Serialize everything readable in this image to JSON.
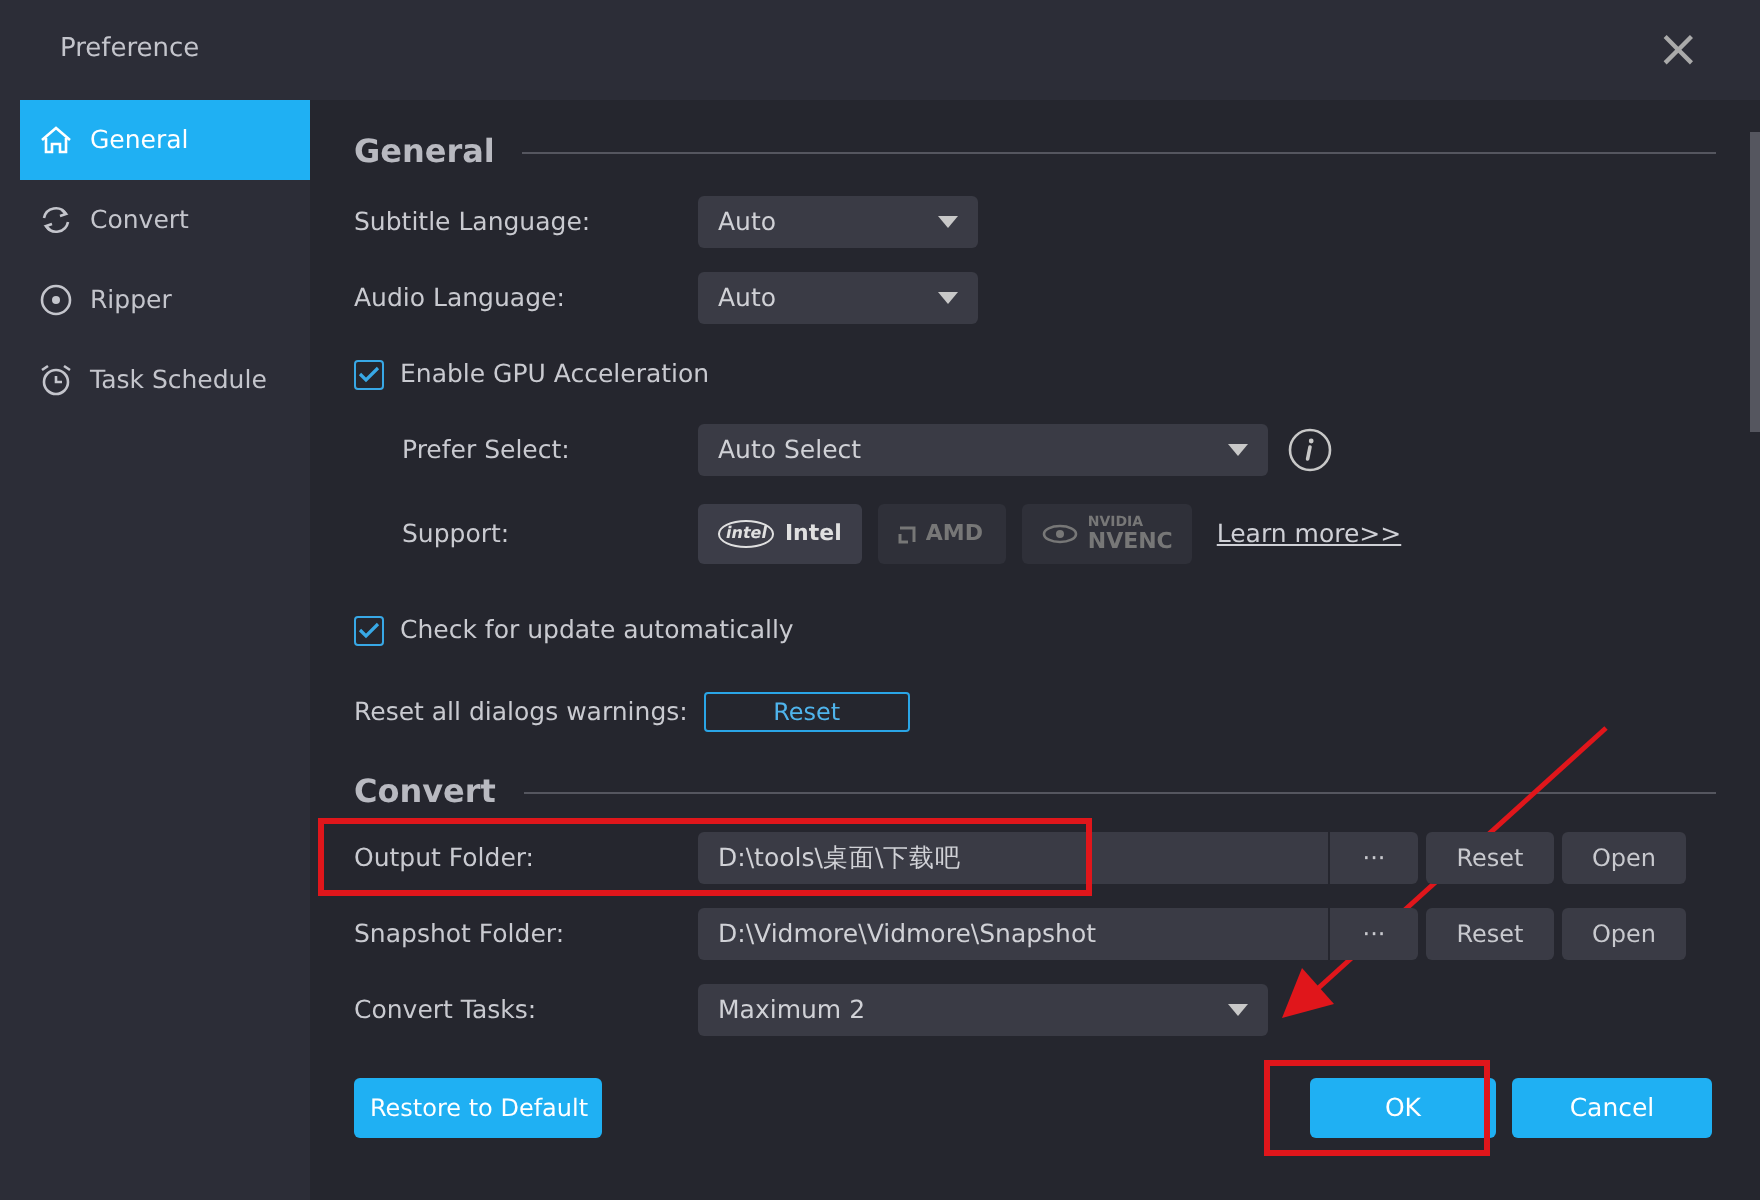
{
  "window": {
    "title": "Preference",
    "close": "×"
  },
  "sidebar": {
    "items": [
      {
        "label": "General",
        "selected": true
      },
      {
        "label": "Convert",
        "selected": false
      },
      {
        "label": "Ripper",
        "selected": false
      },
      {
        "label": "Task Schedule",
        "selected": false
      }
    ]
  },
  "general": {
    "title": "General",
    "subtitle_language": {
      "label": "Subtitle Language:",
      "value": "Auto"
    },
    "audio_language": {
      "label": "Audio Language:",
      "value": "Auto"
    },
    "gpu": {
      "label": "Enable GPU Acceleration",
      "checked": true
    },
    "prefer_select": {
      "label": "Prefer Select:",
      "value": "Auto Select"
    },
    "support": {
      "label": "Support:",
      "items": [
        {
          "kind": "intel",
          "logo": "intel",
          "name": "Intel",
          "selected": true
        },
        {
          "kind": "amd",
          "name": "AMD",
          "selected": false
        },
        {
          "kind": "nvidia",
          "logo": "NVIDIA",
          "name": "NVENC",
          "selected": false
        }
      ],
      "link": "Learn more>>"
    },
    "update": {
      "label": "Check for update automatically",
      "checked": true
    },
    "reset_warnings": {
      "label": "Reset all dialogs warnings:",
      "button": "Reset"
    }
  },
  "convert": {
    "title": "Convert",
    "folders": [
      {
        "label": "Output Folder:",
        "value": "D:\\tools\\桌面\\下载吧",
        "browse": "···",
        "reset": "Reset",
        "open": "Open",
        "highlighted": true
      },
      {
        "label": "Snapshot Folder:",
        "value": "D:\\Vidmore\\Vidmore\\Snapshot",
        "browse": "···",
        "reset": "Reset",
        "open": "Open",
        "highlighted": false
      }
    ],
    "tasks": {
      "label": "Convert Tasks:",
      "value": "Maximum 2"
    }
  },
  "footer": {
    "restore": "Restore to Default",
    "ok": {
      "label": "OK",
      "highlighted": true,
      "arrow": true
    },
    "cancel": "Cancel"
  }
}
